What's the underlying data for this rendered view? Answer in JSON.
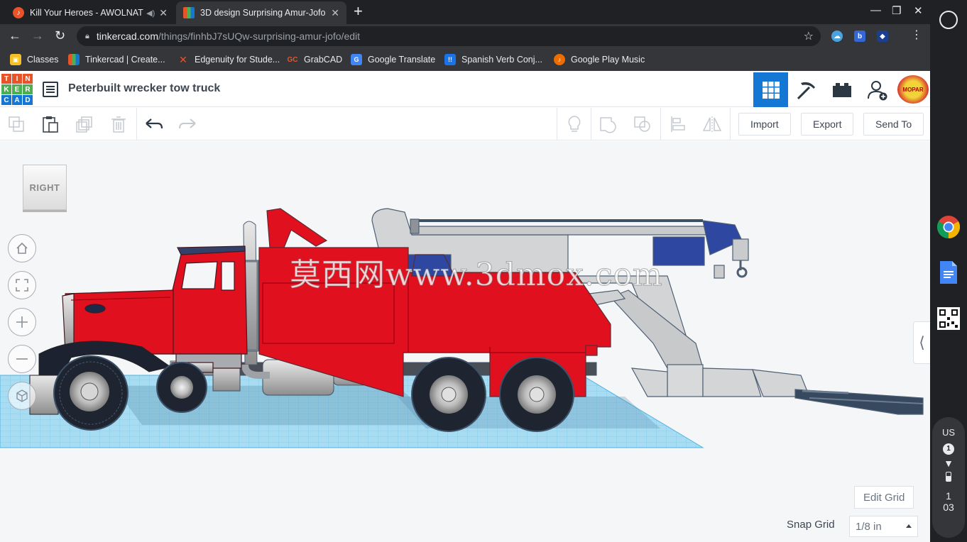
{
  "browser": {
    "tabs": [
      {
        "title": "Kill Your Heroes - AWOLNATION",
        "favicon_color": "#e8542a",
        "active": false
      },
      {
        "title": "3D design Surprising Amur-Jofo",
        "favicon_color": "#f0a400",
        "active": true
      }
    ],
    "url_host": "tinkercad.com",
    "url_path": "/things/finhbJ7sUQw-surprising-amur-jofo/edit",
    "bookmarks": [
      {
        "label": "Classes",
        "icon_color": "#f6c026"
      },
      {
        "label": "Tinkercad | Create...",
        "icon_color": "#1477d4"
      },
      {
        "label": "Edgenuity for Stude...",
        "icon_color": "#e8542a"
      },
      {
        "label": "GrabCAD",
        "icon_color": "#3b3b3b"
      },
      {
        "label": "Google Translate",
        "icon_color": "#4285f4"
      },
      {
        "label": "Spanish Verb Conj...",
        "icon_color": "#1a73e8"
      },
      {
        "label": "Google Play Music",
        "icon_color": "#ef6c00"
      }
    ]
  },
  "tinkercad": {
    "logo_letters": [
      "TIN",
      "KER",
      "CAD"
    ],
    "design_title": "Peterbuilt wrecker tow truck",
    "accent_color": "#1477d4",
    "avatar_text": "MOPAR",
    "toolbar": {
      "import_label": "Import",
      "export_label": "Export",
      "send_to_label": "Send To"
    },
    "workplane": {
      "view_cube_label": "RIGHT",
      "watermark": "莫西网www.3dmox.com",
      "edit_grid_label": "Edit Grid",
      "snap_grid_label": "Snap Grid",
      "snap_grid_value": "1/8 in"
    }
  },
  "shelf": {
    "keyboard": "US",
    "notification_count": "1",
    "time_hour": "1",
    "time_min": "03"
  }
}
